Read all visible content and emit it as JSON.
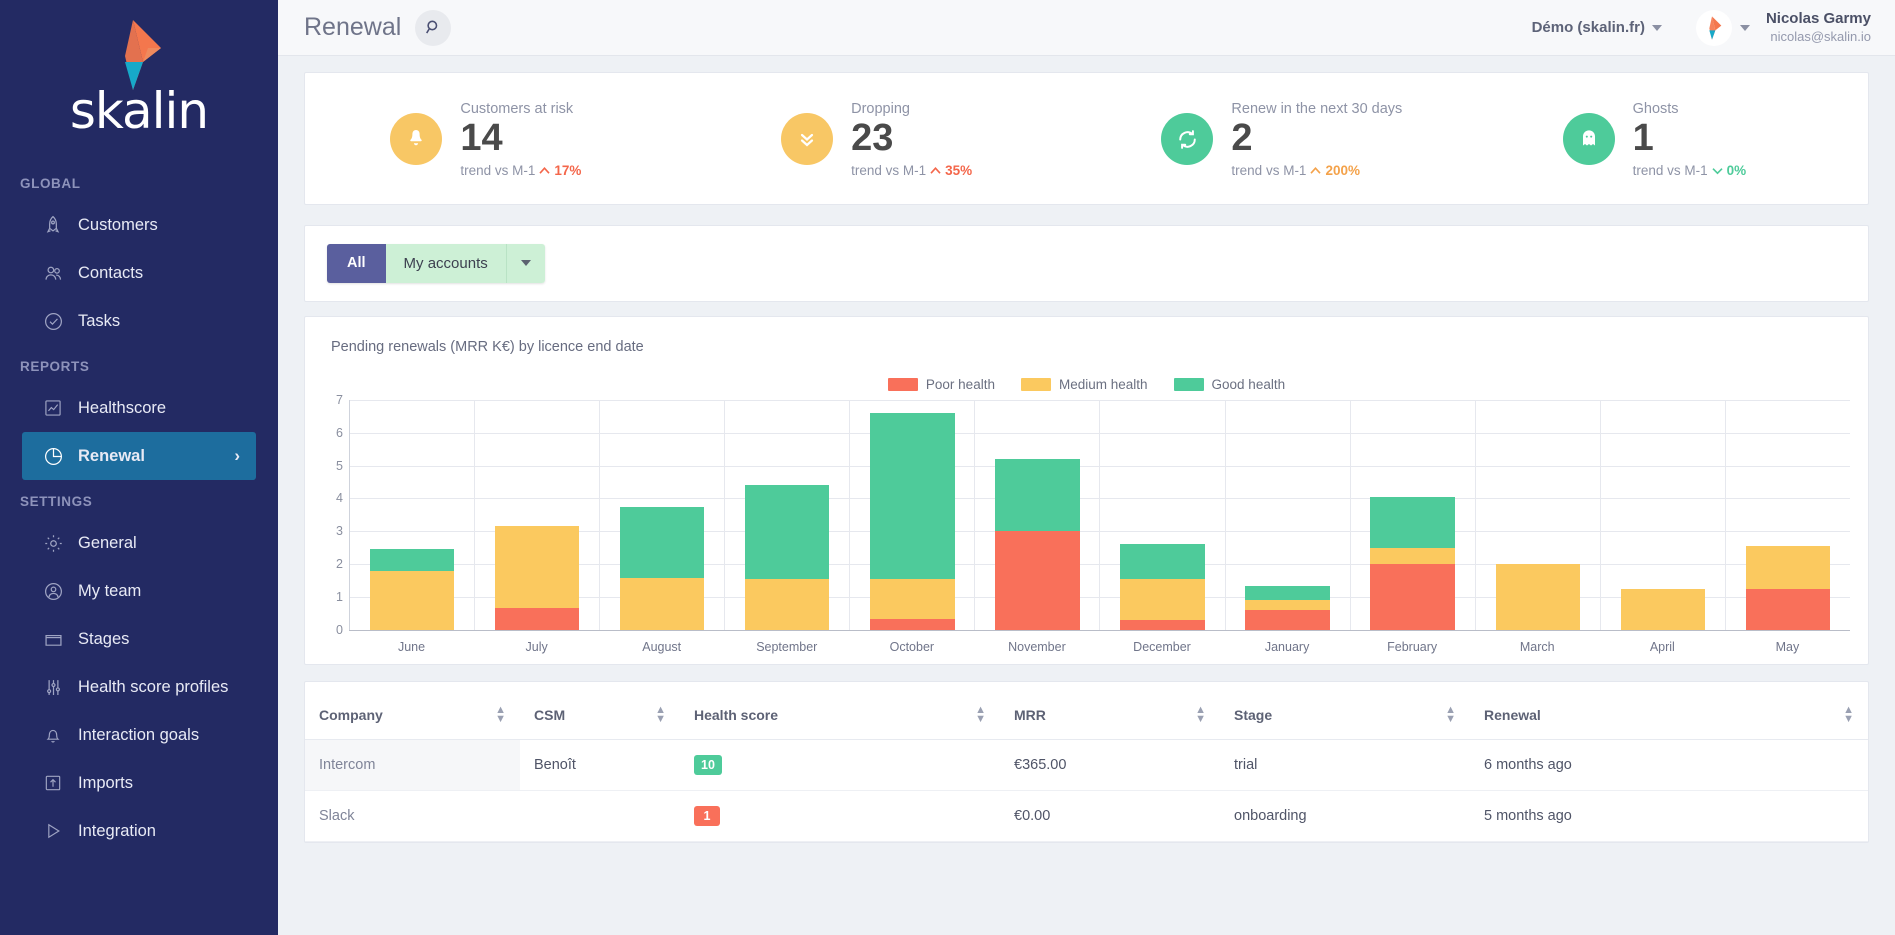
{
  "brand": {
    "name": "skalin",
    "accent_orange": "#f4774d",
    "accent_blue": "#17a9c9",
    "sidebar_bg": "#232a63",
    "active_bg": "#1d6d9e"
  },
  "sidebar": {
    "sections": [
      {
        "title": "GLOBAL",
        "items": [
          {
            "label": "Customers",
            "icon": "rocket-icon",
            "active": false
          },
          {
            "label": "Contacts",
            "icon": "people-icon",
            "active": false
          },
          {
            "label": "Tasks",
            "icon": "check-circle-icon",
            "active": false
          }
        ]
      },
      {
        "title": "REPORTS",
        "items": [
          {
            "label": "Healthscore",
            "icon": "chart-line-icon",
            "active": false
          },
          {
            "label": "Renewal",
            "icon": "pie-chart-icon",
            "active": true,
            "chevron": "›"
          }
        ]
      },
      {
        "title": "SETTINGS",
        "items": [
          {
            "label": "General",
            "icon": "gear-icon",
            "active": false
          },
          {
            "label": "My team",
            "icon": "user-circle-icon",
            "active": false
          },
          {
            "label": "Stages",
            "icon": "folder-icon",
            "active": false
          },
          {
            "label": "Health score profiles",
            "icon": "sliders-icon",
            "active": false
          },
          {
            "label": "Interaction goals",
            "icon": "bell-icon",
            "active": false
          },
          {
            "label": "Imports",
            "icon": "upload-icon",
            "active": false
          },
          {
            "label": "Integration",
            "icon": "play-icon",
            "active": false
          }
        ]
      }
    ]
  },
  "header": {
    "title": "Renewal",
    "search_icon": "search-icon",
    "tenant": "Démo (skalin.fr)",
    "user_name": "Nicolas Garmy",
    "user_email": "nicolas@skalin.io"
  },
  "kpis": [
    {
      "label": "Customers at risk",
      "value": "14",
      "trend_prefix": "trend vs M-1",
      "trend_value": "17%",
      "trend_dir": "up",
      "icon": "bell-icon",
      "color": "#f8c765"
    },
    {
      "label": "Dropping",
      "value": "23",
      "trend_prefix": "trend vs M-1",
      "trend_value": "35%",
      "trend_dir": "up",
      "icon": "double-chevron-down-icon",
      "color": "#f8c765"
    },
    {
      "label": "Renew in the next 30 days",
      "value": "2",
      "trend_prefix": "trend vs M-1",
      "trend_value": "200%",
      "trend_dir": "up",
      "icon": "refresh-icon",
      "color": "#4ecb9a"
    },
    {
      "label": "Ghosts",
      "value": "1",
      "trend_prefix": "trend vs M-1",
      "trend_value": "0%",
      "trend_dir": "flat",
      "icon": "ghost-icon",
      "color": "#4ecb9a"
    }
  ],
  "filters": {
    "all_label": "All",
    "my_accounts_label": "My accounts",
    "dropdown_icon": "chevron-down-icon"
  },
  "chart_data": {
    "type": "bar",
    "title": "Pending renewals (MRR K€) by licence end date",
    "xlabel": "",
    "ylabel": "",
    "ylim": [
      0,
      7
    ],
    "yticks": [
      0,
      1,
      2,
      3,
      4,
      5,
      6,
      7
    ],
    "grid": true,
    "legend_position": "top-center",
    "stacked": true,
    "categories": [
      "June",
      "July",
      "August",
      "September",
      "October",
      "November",
      "December",
      "January",
      "February",
      "March",
      "April",
      "May"
    ],
    "series": [
      {
        "name": "Poor health",
        "color": "#f9705a",
        "values": [
          0,
          0.67,
          0,
          0,
          0.33,
          3.0,
          0.3,
          0.6,
          2.0,
          0,
          0,
          1.25
        ]
      },
      {
        "name": "Medium health",
        "color": "#fbc95f",
        "values": [
          1.8,
          2.5,
          1.58,
          1.55,
          1.22,
          0,
          1.25,
          0.3,
          0.5,
          2.0,
          1.25,
          1.3
        ]
      },
      {
        "name": "Good health",
        "color": "#4ecb9a",
        "values": [
          0.67,
          0,
          2.17,
          2.87,
          5.05,
          2.2,
          1.05,
          0.45,
          1.55,
          0,
          0,
          0
        ]
      }
    ]
  },
  "table": {
    "columns": [
      "Company",
      "CSM",
      "Health score",
      "MRR",
      "Stage",
      "Renewal"
    ],
    "rows": [
      {
        "company": "Intercom",
        "csm": "Benoît",
        "score": "10",
        "score_color": "#4ecb9a",
        "mrr": "€365.00",
        "stage": "trial",
        "renewal": "6 months ago"
      },
      {
        "company": "Slack",
        "csm": "",
        "score": "1",
        "score_color": "#f9705a",
        "mrr": "€0.00",
        "stage": "onboarding",
        "renewal": "5 months ago"
      }
    ]
  }
}
